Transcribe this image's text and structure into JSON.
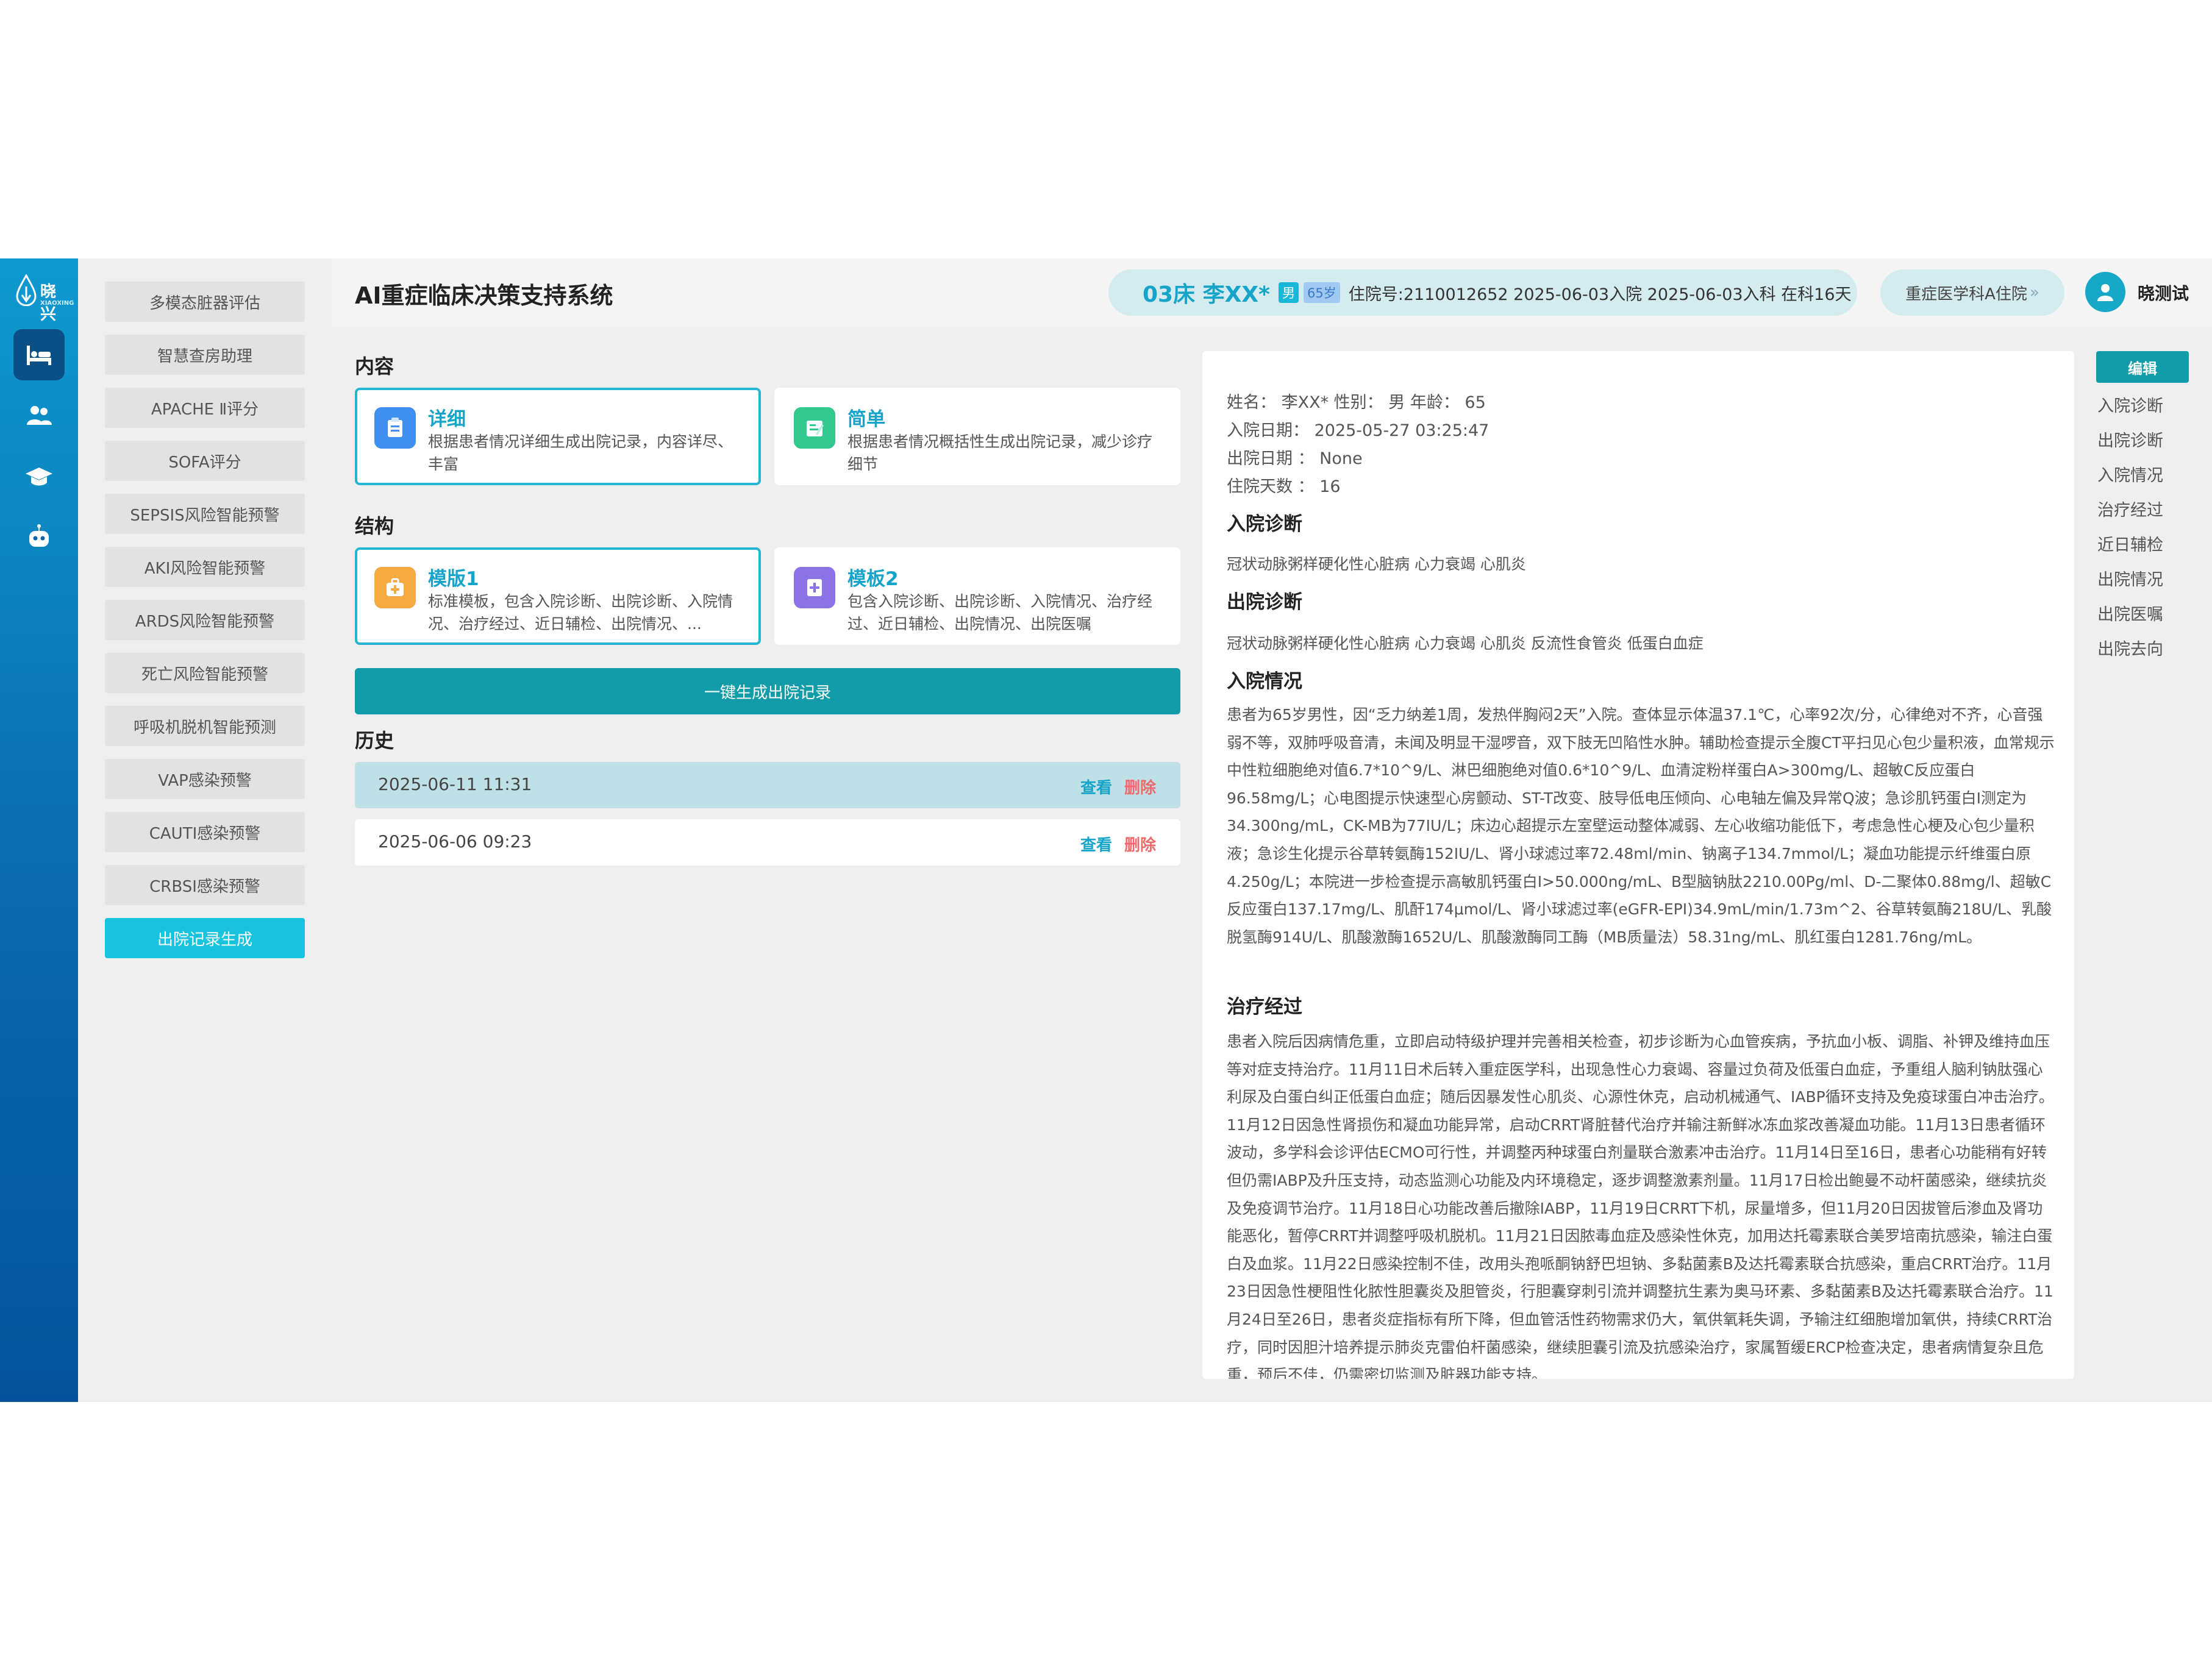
{
  "brand": {
    "logo_text": "晓兴",
    "logo_sub": "XIAOXING"
  },
  "colors": {
    "accent": "#16a4c9",
    "primary_button": "#129ba8",
    "active_menu": "#19c3de",
    "delete": "#ee6b6b"
  },
  "rail": {
    "items": [
      {
        "icon": "bed-icon",
        "active": true
      },
      {
        "icon": "users-icon",
        "active": false
      },
      {
        "icon": "graduation-cap-icon",
        "active": false
      },
      {
        "icon": "robot-icon",
        "active": false
      }
    ]
  },
  "menu": {
    "items": [
      {
        "label": "多模态脏器评估"
      },
      {
        "label": "智慧查房助理"
      },
      {
        "label": "APACHE Ⅱ评分"
      },
      {
        "label": "SOFA评分"
      },
      {
        "label": "SEPSIS风险智能预警"
      },
      {
        "label": "AKI风险智能预警"
      },
      {
        "label": "ARDS风险智能预警"
      },
      {
        "label": "死亡风险智能预警"
      },
      {
        "label": "呼吸机脱机智能预测"
      },
      {
        "label": "VAP感染预警"
      },
      {
        "label": "CAUTI感染预警"
      },
      {
        "label": "CRBSI感染预警"
      },
      {
        "label": "出院记录生成",
        "active": true
      }
    ]
  },
  "header": {
    "title": "AI重症临床决策支持系统",
    "patient": {
      "bed_name": "03床 李XX*",
      "sex": "男",
      "age": "65岁",
      "info": "住院号:2110012652  2025-06-03入院  2025-06-03入科  在科16天"
    },
    "ward": "重症医学科A住院",
    "user": "晓测试"
  },
  "content_section": {
    "label": "内容",
    "options": [
      {
        "title": "详细",
        "desc": "根据患者情况详细生成出院记录，内容详尽、丰富",
        "icon": "clipboard-icon",
        "selected": true
      },
      {
        "title": "简单",
        "desc": "根据患者情况概括性生成出院记录，减少诊疗细节",
        "icon": "edit-note-icon",
        "selected": false
      }
    ]
  },
  "structure_section": {
    "label": "结构",
    "options": [
      {
        "title": "模版1",
        "desc": "标准模板，包含入院诊断、出院诊断、入院情况、治疗经过、近日辅检、出院情况、...",
        "icon": "medical-kit-icon",
        "selected": true
      },
      {
        "title": "模板2",
        "desc": "包含入院诊断、出院诊断、入院情况、治疗经过、近日辅检、出院情况、出院医嘱",
        "icon": "add-document-icon",
        "selected": false
      }
    ]
  },
  "generate_button": "一键生成出院记录",
  "history": {
    "label": "历史",
    "view_label": "查看",
    "delete_label": "删除",
    "rows": [
      {
        "date": "2025-06-11 11:31",
        "active": true
      },
      {
        "date": "2025-06-06 09:23",
        "active": false
      }
    ]
  },
  "document": {
    "name_line": "姓名： 李XX* 性别： 男 年龄： 65",
    "admit_date": "入院日期： 2025-05-27 03:25:47",
    "discharge_date": "出院日期 ： None",
    "stay_days": "住院天数 ： 16",
    "admission_dx_title": "入院诊断",
    "admission_dx": "冠状动脉粥样硬化性心脏病 心力衰竭 心肌炎",
    "discharge_dx_title": "出院诊断",
    "discharge_dx": "冠状动脉粥样硬化性心脏病 心力衰竭 心肌炎 反流性食管炎 低蛋白血症",
    "admission_status_title": "入院情况",
    "admission_status": "患者为65岁男性，因“乏力纳差1周，发热伴胸闷2天”入院。查体显示体温37.1℃，心率92次/分，心律绝对不齐，心音强弱不等，双肺呼吸音清，未闻及明显干湿啰音，双下肢无凹陷性水肿。辅助检查提示全腹CT平扫见心包少量积液，血常规示中性粒细胞绝对值6.7*10^9/L、淋巴细胞绝对值0.6*10^9/L、血清淀粉样蛋白A>300mg/L、超敏C反应蛋白96.58mg/L；心电图提示快速型心房颤动、ST-T改变、肢导低电压倾向、心电轴左偏及异常Q波；急诊肌钙蛋白I测定为34.300ng/mL，CK-MB为77IU/L；床边心超提示左室壁运动整体减弱、左心收缩功能低下，考虑急性心梗及心包少量积液；急诊生化提示谷草转氨酶152IU/L、肾小球滤过率72.48ml/min、钠离子134.7mmol/L；凝血功能提示纤维蛋白原4.250g/L；本院进一步检查提示高敏肌钙蛋白I>50.000ng/mL、B型脑钠肽2210.00Pg/ml、D-二聚体0.88mg/l、超敏C反应蛋白137.17mg/L、肌酐174μmol/L、肾小球滤过率(eGFR-EPI)34.9mL/min/1.73m^2、谷草转氨酶218U/L、乳酸脱氢酶914U/L、肌酸激酶1652U/L、肌酸激酶同工酶（MB质量法）58.31ng/mL、肌红蛋白1281.76ng/mL。",
    "treatment_title": "治疗经过",
    "treatment": "患者入院后因病情危重，立即启动特级护理并完善相关检查，初步诊断为心血管疾病，予抗血小板、调脂、补钾及维持血压等对症支持治疗。11月11日术后转入重症医学科，出现急性心力衰竭、容量过负荷及低蛋白血症，予重组人脑利钠肽强心利尿及白蛋白纠正低蛋白血症；随后因暴发性心肌炎、心源性休克，启动机械通气、IABP循环支持及免疫球蛋白冲击治疗。11月12日因急性肾损伤和凝血功能异常，启动CRRT肾脏替代治疗并输注新鲜冰冻血浆改善凝血功能。11月13日患者循环波动，多学科会诊评估ECMO可行性，并调整丙种球蛋白剂量联合激素冲击治疗。11月14日至16日，患者心功能稍有好转但仍需IABP及升压支持，动态监测心功能及内环境稳定，逐步调整激素剂量。11月17日检出鲍曼不动杆菌感染，继续抗炎及免疫调节治疗。11月18日心功能改善后撤除IABP，11月19日CRRT下机，尿量增多，但11月20日因拔管后渗血及肾功能恶化，暂停CRRT并调整呼吸机脱机。11月21日因脓毒血症及感染性休克，加用达托霉素联合美罗培南抗感染，输注白蛋白及血浆。11月22日感染控制不佳，改用头孢哌酮钠舒巴坦钠、多黏菌素B及达托霉素联合抗感染，重启CRRT治疗。11月23日因急性梗阻性化脓性胆囊炎及胆管炎，行胆囊穿刺引流并调整抗生素为奥马环素、多黏菌素B及达托霉素联合治疗。11月24日至26日，患者炎症指标有所下降，但血管活性药物需求仍大，氧供氧耗失调，予输注红细胞增加氧供，持续CRRT治疗，同时因胆汁培养提示肺炎克雷伯杆菌感染，继续胆囊引流及抗感染治疗，家属暂缓ERCP检查决定，患者病情复杂且危重，预后不佳，仍需密切监测及脏器功能支持。"
  },
  "outline": {
    "edit_label": "编辑",
    "items": [
      "入院诊断",
      "出院诊断",
      "入院情况",
      "治疗经过",
      "近日辅检",
      "出院情况",
      "出院医嘱",
      "出院去向"
    ]
  }
}
